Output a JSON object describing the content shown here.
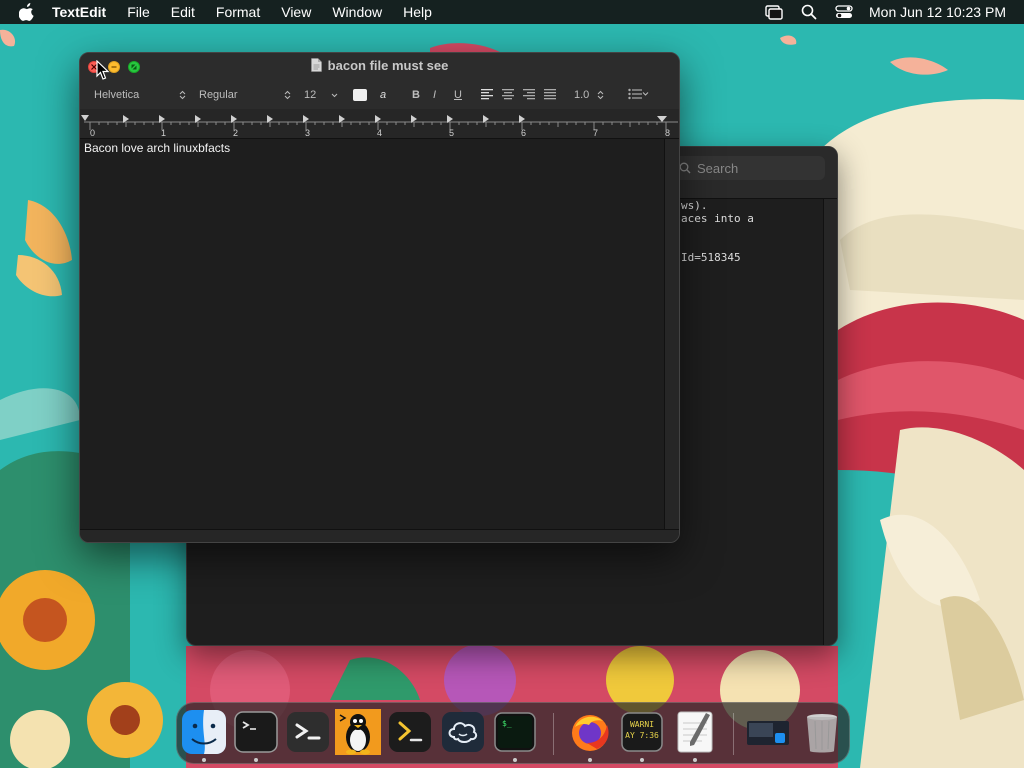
{
  "menubar": {
    "app_name": "TextEdit",
    "items": [
      "File",
      "Edit",
      "Format",
      "View",
      "Window",
      "Help"
    ],
    "clock": "Mon Jun 12  10:23 PM",
    "status_icons": [
      "screen-mirroring-icon",
      "search-icon",
      "control-center-icon"
    ]
  },
  "textedit": {
    "title": "bacon file must see",
    "font_family": "Helvetica",
    "font_style": "Regular",
    "font_size": "12",
    "line_spacing": "1.0",
    "bold_label": "B",
    "italic_label": "I",
    "underline_label": "U",
    "highlight_label": "a",
    "ruler_labels": [
      "0",
      "1",
      "2",
      "3",
      "4",
      "5",
      "6",
      "7",
      "8"
    ],
    "document_text": "Bacon love arch linuxbfacts"
  },
  "terminal": {
    "search_placeholder": "Search",
    "lines": [
      "ws).",
      "aces into a",
      "",
      "",
      "Id=518345"
    ]
  },
  "dock": {
    "items": [
      "finder-icon",
      "terminal-icon",
      "powershell-icon",
      "linux-tux-icon",
      "prompt-icon",
      "chatgpt-icon",
      "iterm-icon",
      "firefox-icon",
      "console-icon",
      "textedit-icon",
      "desktop-preview-icon",
      "trash-icon"
    ],
    "console_text_line1": "WARNI",
    "console_text_line2": "AY 7:36"
  },
  "colors": {
    "close": "#fe5f57",
    "minimize": "#febc2e",
    "zoom": "#28c840",
    "window_bg": "#1e1e1e"
  }
}
